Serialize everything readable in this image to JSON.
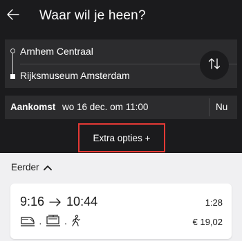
{
  "header": {
    "title": "Waar wil je heen?",
    "back_icon": "arrow-left-icon"
  },
  "route": {
    "from": "Arnhem Centraal",
    "to": "Rijksmuseum Amsterdam",
    "swap_icon": "swap-vertical-icon"
  },
  "time": {
    "mode": "Aankomst",
    "datetime": "wo 16 dec. om 11:00",
    "now_label": "Nu"
  },
  "extra_options": {
    "label": "Extra opties +",
    "highlight_color": "#e53935"
  },
  "earlier": {
    "label": "Eerder",
    "icon": "chevron-up-icon"
  },
  "trips": [
    {
      "depart": "9:16",
      "arrive": "10:44",
      "duration": "1:28",
      "price": "€ 19,02",
      "modes": [
        "train-icon",
        "tram-icon",
        "walking-icon"
      ]
    }
  ],
  "colors": {
    "dark_bg": "#1b1b1d",
    "panel_bg": "#2c2c2e",
    "page_bg": "#f0f0f2"
  }
}
